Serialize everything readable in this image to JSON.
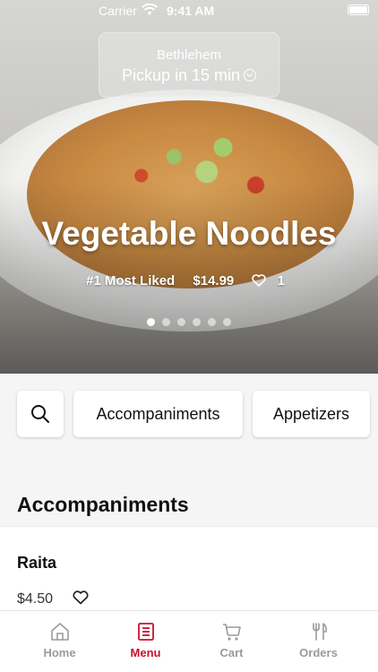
{
  "status_bar": {
    "carrier": "Carrier",
    "time": "9:41 AM"
  },
  "hero": {
    "location": "Bethlehem",
    "pickup": "Pickup in 15 min",
    "dish_title": "Vegetable Noodles",
    "badge": "#1 Most Liked",
    "price": "$14.99",
    "likes": "1",
    "carousel_total": 6,
    "carousel_active": 1
  },
  "categories": {
    "search_icon": "search-icon",
    "items": [
      "Accompaniments",
      "Appetizers"
    ]
  },
  "section": {
    "title": "Accompaniments"
  },
  "menu_item": {
    "name": "Raita",
    "price": "$4.50",
    "fav_icon": "heart-icon"
  },
  "tab_bar": {
    "tabs": [
      {
        "label": "Home",
        "icon": "home-icon"
      },
      {
        "label": "Menu",
        "icon": "menu-icon"
      },
      {
        "label": "Cart",
        "icon": "cart-icon"
      },
      {
        "label": "Orders",
        "icon": "utensils-icon"
      }
    ],
    "active": "Menu"
  },
  "colors": {
    "accent": "#c8102e",
    "inactive": "#9a9a9a"
  }
}
